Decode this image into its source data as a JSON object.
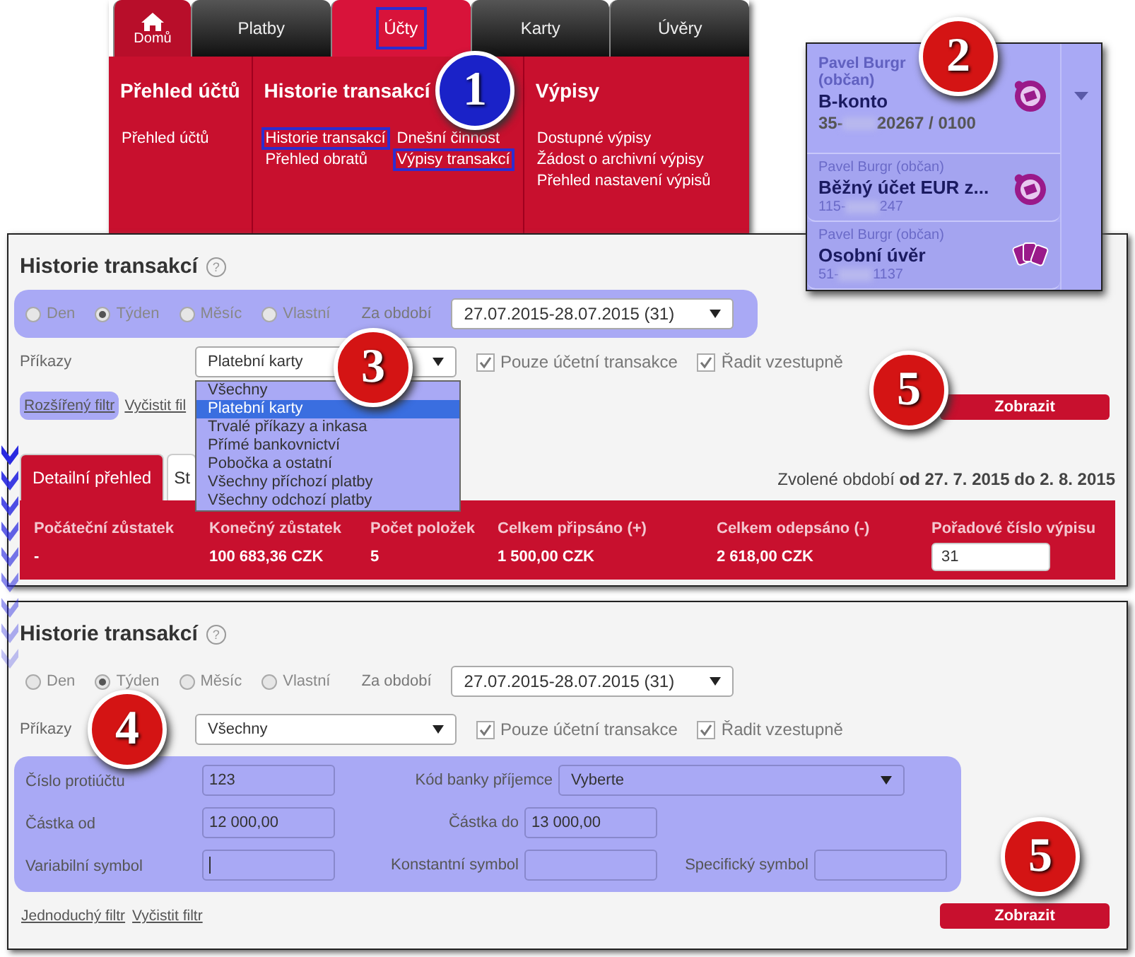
{
  "nav_menu": {
    "tabs": [
      {
        "label": "Domů",
        "kind": "home",
        "selected": false,
        "highlighted": false
      },
      {
        "label": "Platby",
        "kind": "tab",
        "selected": false,
        "highlighted": false
      },
      {
        "label": "Účty",
        "kind": "tab",
        "selected": true,
        "highlighted": true
      },
      {
        "label": "Karty",
        "kind": "tab",
        "selected": false,
        "highlighted": false
      },
      {
        "label": "Úvěry",
        "kind": "tab",
        "selected": false,
        "highlighted": false
      }
    ],
    "columns": [
      {
        "title": "Přehled účtů",
        "links": [
          {
            "label": "Přehled účtů",
            "highlighted": false
          }
        ]
      },
      {
        "title": "Historie transakcí",
        "links": [
          {
            "label": "Historie transakcí",
            "highlighted": true
          },
          {
            "label": "Dnešní činnost",
            "highlighted": false
          },
          {
            "label": "Přehled obratů",
            "highlighted": false
          },
          {
            "label": "Výpisy transakcí",
            "highlighted": true
          }
        ]
      },
      {
        "title": "Výpisy",
        "links": [
          {
            "label": "Dostupné výpisy",
            "highlighted": false
          },
          {
            "label": "Žádost o archivní výpisy",
            "highlighted": false
          },
          {
            "label": "Přehled nastavení výpisů",
            "highlighted": false
          }
        ]
      }
    ]
  },
  "accounts_dropdown": {
    "items": [
      {
        "owner": "Pavel Burgr (občan)",
        "name": "B-konto",
        "number_prefix": "35-",
        "number_suffix": "20267 / 0100",
        "kind": "account",
        "selected": true
      },
      {
        "owner": "Pavel Burgr (občan)",
        "name": "Běžný účet EUR z...",
        "number_prefix": "115-",
        "number_suffix": "247",
        "kind": "account",
        "selected": false
      },
      {
        "owner": "Pavel Burgr (občan)",
        "name": "Osobní úvěr",
        "number_prefix": "51-",
        "number_suffix": "1137",
        "kind": "loan",
        "selected": false
      }
    ]
  },
  "history_simple": {
    "title": "Historie transakcí",
    "help": "?",
    "period_highlighted": true,
    "periods": [
      {
        "label": "Den",
        "selected": false
      },
      {
        "label": "Týden",
        "selected": true
      },
      {
        "label": "Měsíc",
        "selected": false
      },
      {
        "label": "Vlastní",
        "selected": false
      }
    ],
    "period_label": "Za období",
    "period_value": "27.07.2015-28.07.2015 (31)",
    "commands_label": "Příkazy",
    "commands_value": "Platební karty",
    "commands_options": [
      {
        "label": "Všechny",
        "selected": false
      },
      {
        "label": "Platební karty",
        "selected": true
      },
      {
        "label": "Trvalé příkazy a inkasa",
        "selected": false
      },
      {
        "label": "Přímé bankovnictví",
        "selected": false
      },
      {
        "label": "Pobočka a ostatní",
        "selected": false
      },
      {
        "label": "Všechny příchozí platby",
        "selected": false
      },
      {
        "label": "Všechny odchozí platby",
        "selected": false
      }
    ],
    "checkboxes": [
      {
        "label": "Pouze účetní transakce",
        "checked": true
      },
      {
        "label": "Řadit vzestupně",
        "checked": true
      }
    ],
    "filter_links": [
      {
        "label": "Rozšířený filtr",
        "highlighted": true
      },
      {
        "label": "Vyčistit fil",
        "highlighted": false
      }
    ],
    "submit": "Zobrazit",
    "tabs": [
      {
        "label": "Detailní přehled",
        "selected": true
      },
      {
        "label": "St",
        "selected": false
      }
    ],
    "period_summary": "Zvolené období **od 27. 7. 2015 do 2. 8. 2015**",
    "summary": [
      {
        "header": "Počáteční zůstatek",
        "value": "-",
        "kind": "text"
      },
      {
        "header": "Konečný zůstatek",
        "value": "100 683,36 CZK",
        "kind": "text"
      },
      {
        "header": "Počet položek",
        "value": "5",
        "kind": "text"
      },
      {
        "header": "Celkem připsáno (+)",
        "value": "1 500,00 CZK",
        "kind": "text"
      },
      {
        "header": "Celkem odepsáno (-)",
        "value": "2 618,00 CZK",
        "kind": "text"
      },
      {
        "header": "Pořadové číslo výpisu",
        "value": "31",
        "kind": "input"
      }
    ]
  },
  "history_advanced": {
    "title": "Historie transakcí",
    "help": "?",
    "periods": [
      {
        "label": "Den",
        "selected": false
      },
      {
        "label": "Týden",
        "selected": true
      },
      {
        "label": "Měsíc",
        "selected": false
      },
      {
        "label": "Vlastní",
        "selected": false
      }
    ],
    "period_label": "Za období",
    "period_value": "27.07.2015-28.07.2015 (31)",
    "commands_label": "Příkazy",
    "commands_value": "Všechny",
    "checkboxes": [
      {
        "label": "Pouze účetní transakce",
        "checked": true
      },
      {
        "label": "Řadit vzestupně",
        "checked": true
      }
    ],
    "advanced_rows": [
      [
        {
          "label": "Číslo protiúčtu",
          "value": "123",
          "kind": "text"
        },
        {
          "label": "Kód banky příjemce",
          "value": "Vyberte",
          "kind": "select"
        }
      ],
      [
        {
          "label": "Částka od",
          "value": "12 000,00",
          "kind": "text"
        },
        {
          "label": "Částka do",
          "value": "13 000,00",
          "kind": "text"
        }
      ],
      [
        {
          "label": "Variabilní symbol",
          "kind": "text",
          "focused": true
        },
        {
          "label": "Konstantní symbol",
          "kind": "text"
        },
        {
          "label": "Specifický symbol",
          "kind": "text"
        }
      ]
    ],
    "filter_links": [
      {
        "label": "Jednoduchý filtr",
        "highlighted": false
      },
      {
        "label": "Vyčistit filtr",
        "highlighted": false
      }
    ],
    "submit": "Zobrazit"
  },
  "callouts": [
    {
      "label": "1",
      "color": "#1a22c8"
    },
    {
      "label": "2",
      "color": "#d41414"
    },
    {
      "label": "3",
      "color": "#d41414"
    },
    {
      "label": "4",
      "color": "#d41414"
    },
    {
      "label": "5",
      "color": "#d41414"
    },
    {
      "label": "5",
      "color": "#d41414"
    }
  ]
}
